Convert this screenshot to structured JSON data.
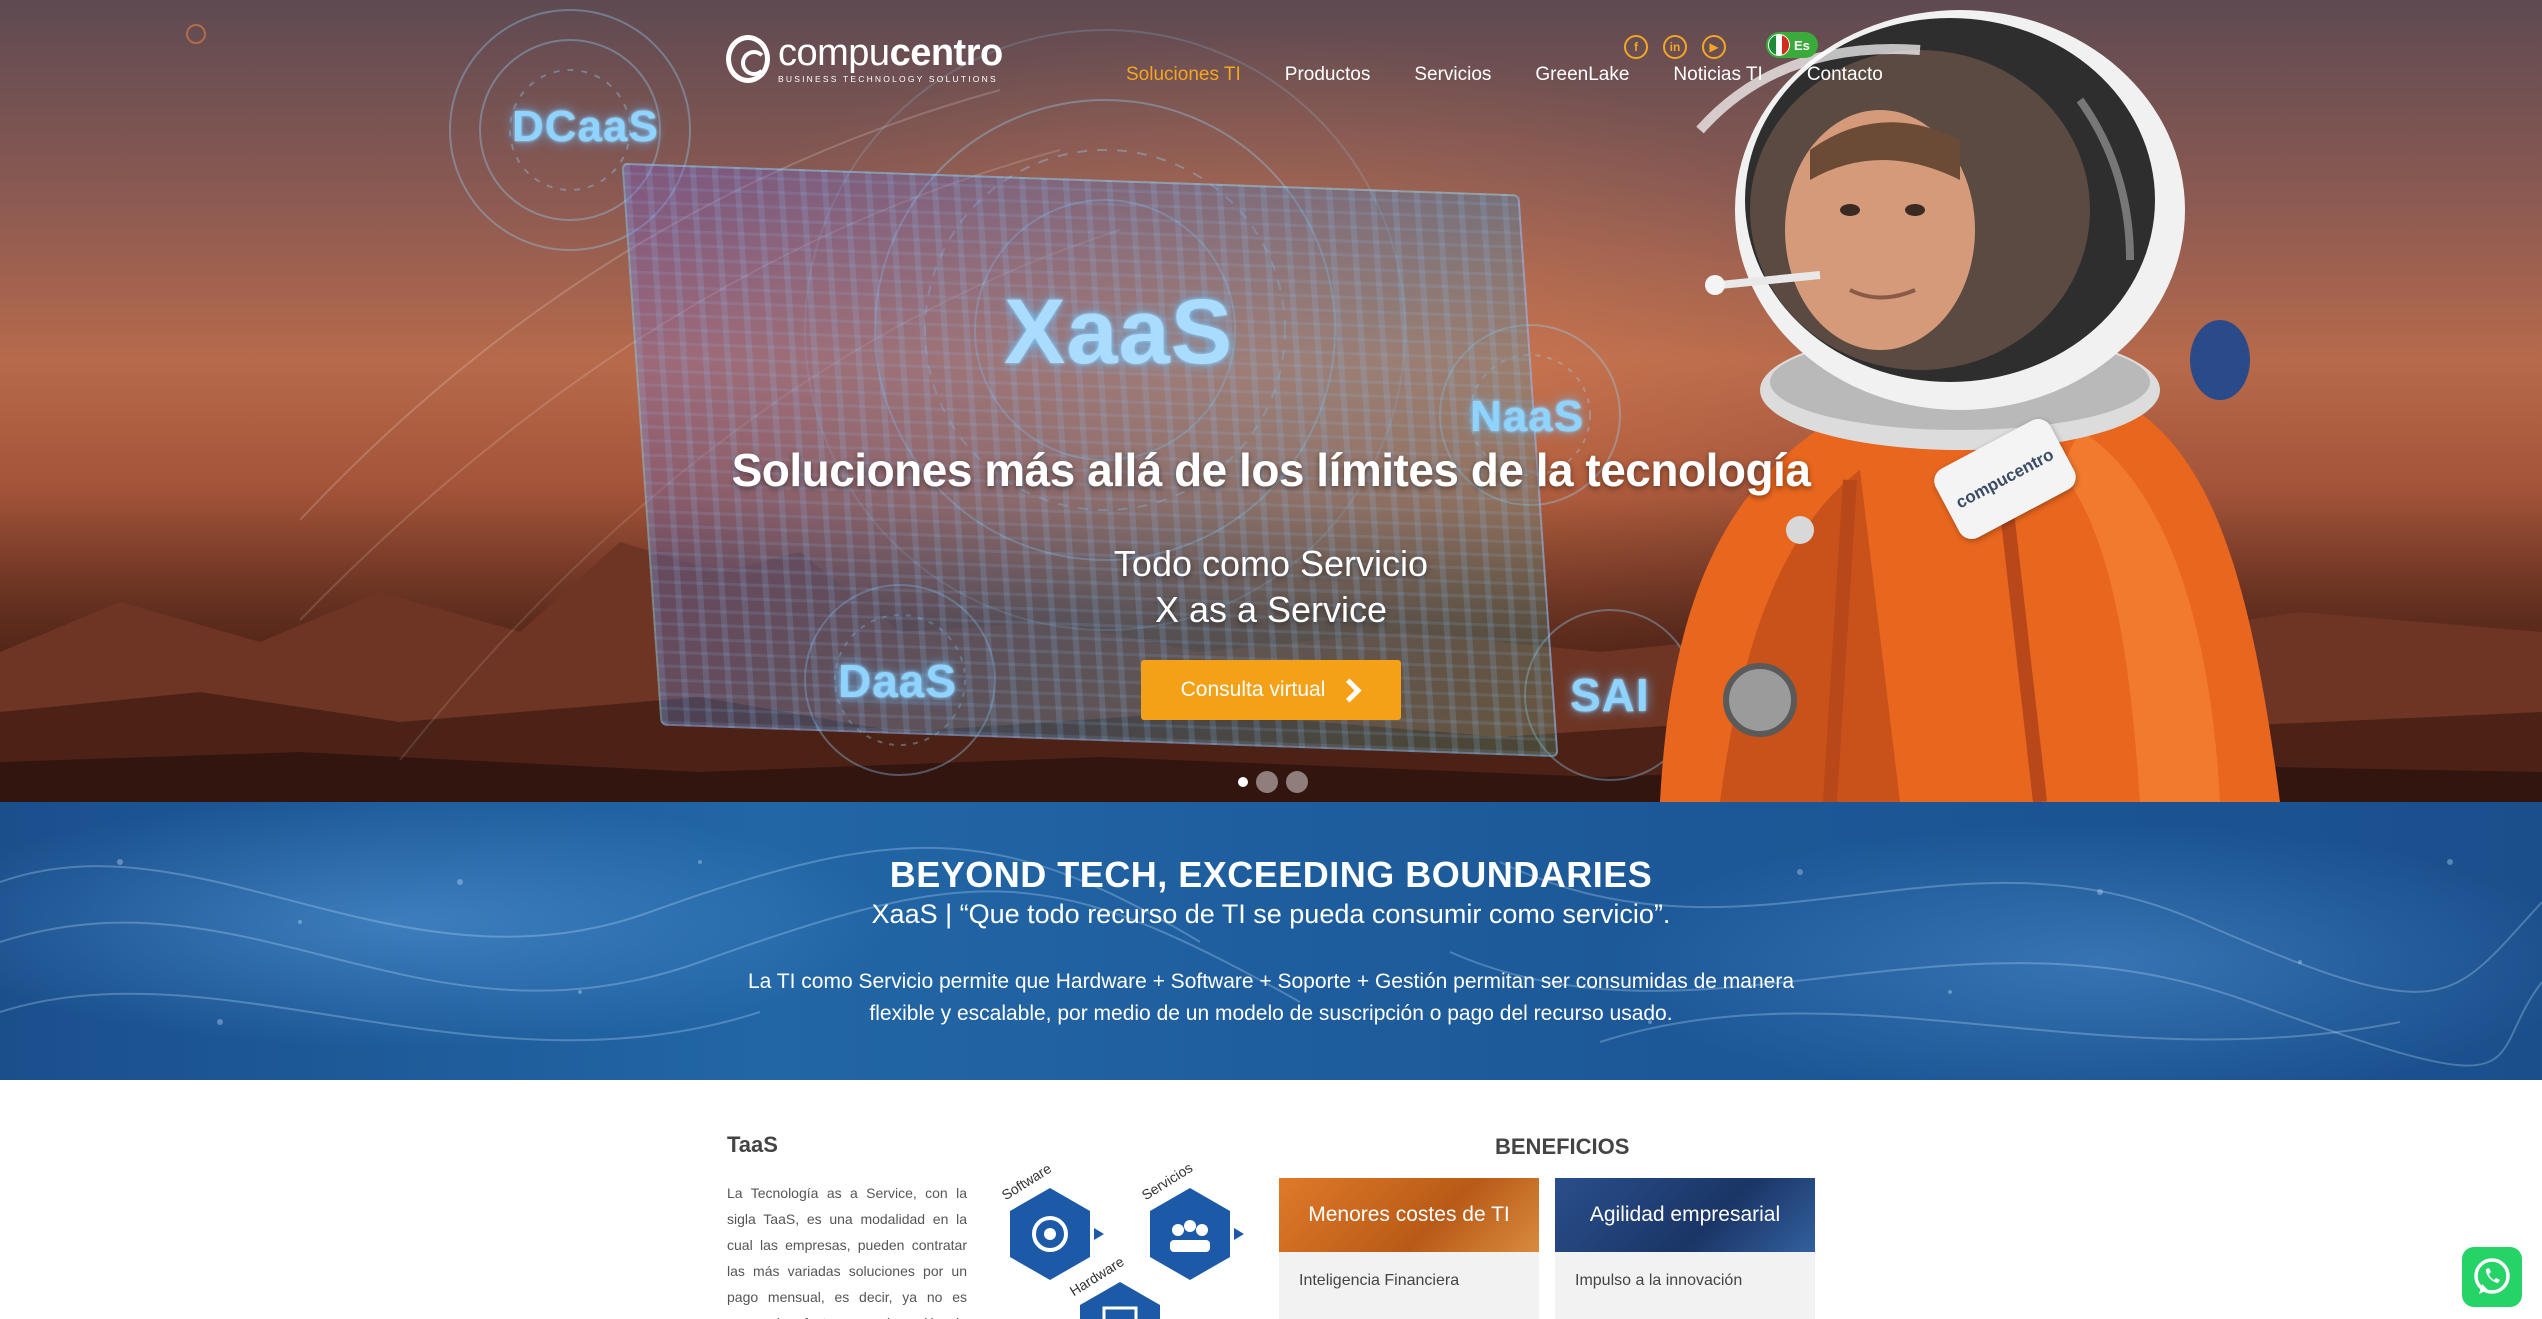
{
  "brand": {
    "name_light": "compu",
    "name_bold": "centro",
    "tagline": "BUSINESS TECHNOLOGY SOLUTIONS"
  },
  "nav": {
    "items": [
      {
        "label": "Soluciones TI",
        "active": true
      },
      {
        "label": "Productos",
        "active": false
      },
      {
        "label": "Servicios",
        "active": false
      },
      {
        "label": "GreenLake",
        "active": false
      },
      {
        "label": "Noticias TI",
        "active": false
      },
      {
        "label": "Contacto",
        "active": false
      }
    ]
  },
  "social": {
    "facebook": "f",
    "linkedin": "in",
    "youtube": "▶"
  },
  "language": {
    "code": "Es"
  },
  "hero": {
    "holo_labels": {
      "dcaas": "DCaaS",
      "xaas": "XaaS",
      "naas": "NaaS",
      "daas": "DaaS",
      "sai": "SAI"
    },
    "badge_text": "compucentro",
    "title": "Soluciones más allá de los límites de la tecnología",
    "subtitle_line1": "Todo como Servicio",
    "subtitle_line2": "X as a Service",
    "cta_label": "Consulta virtual",
    "slide_count": 3,
    "active_slide": 1
  },
  "band": {
    "title": "BEYOND TECH, EXCEEDING BOUNDARIES",
    "subtitle": "XaaS | “Que todo recurso de TI se pueda consumir como servicio”.",
    "text": "La TI como Servicio permite que Hardware + Software + Soporte + Gestión permitan ser consumidas de manera flexible y escalable, por medio de un modelo de suscripción o pago del recurso usado."
  },
  "taas": {
    "title": "TaaS",
    "text": "La Tecnología as a Service, con la sigla TaaS, es una modalidad en la cual las empresas, pueden contratar las más variadas soluciones por un pago mensual, es decir, ya no es necesario efectuar una inversión de uno, una"
  },
  "diagram": {
    "software": "Software",
    "servicios": "Servicios",
    "hardware": "Hardware"
  },
  "benefits": {
    "title": "BENEFICIOS",
    "cards": [
      {
        "title": "Menores costes de TI",
        "item": "Inteligencia Financiera"
      },
      {
        "title": "Agilidad empresarial",
        "item": "Impulso a la innovación"
      }
    ]
  },
  "colors": {
    "accent_orange": "#f4a623",
    "cta_orange": "#f4a117",
    "band_blue": "#1d5a9a",
    "diagram_blue": "#1c5aa8",
    "whatsapp_green": "#25d366"
  }
}
